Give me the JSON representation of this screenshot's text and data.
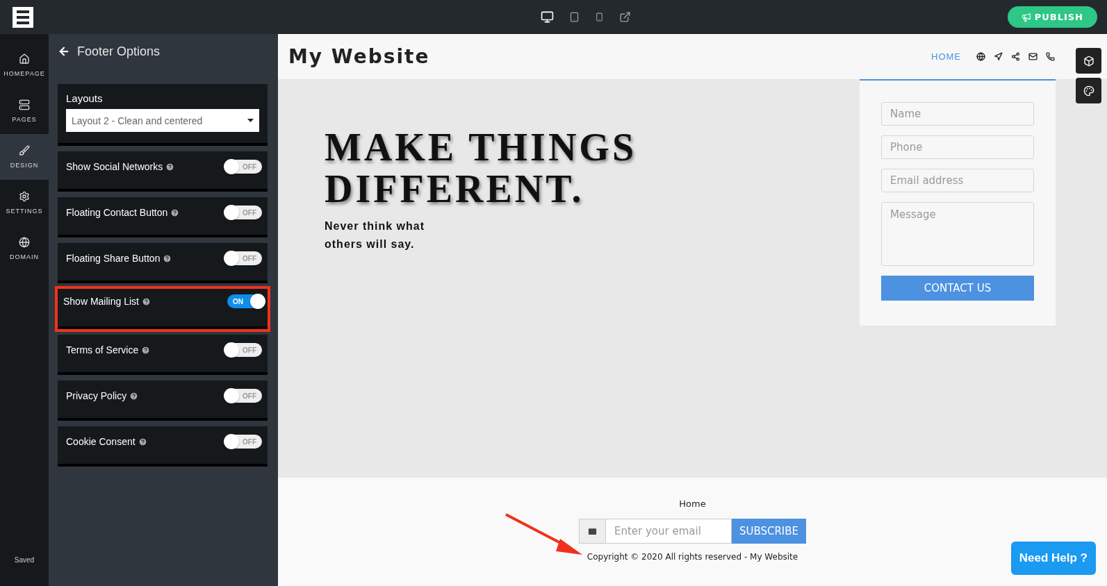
{
  "topbar": {
    "devices": [
      {
        "kind": "desktop",
        "selected": true
      },
      {
        "kind": "tablet",
        "selected": false
      },
      {
        "kind": "phone",
        "selected": false
      },
      {
        "kind": "external",
        "selected": false
      }
    ],
    "publish": "PUBLISH"
  },
  "rail": {
    "items": [
      {
        "kind": "home",
        "label": "HOMEPAGE",
        "selected": false
      },
      {
        "kind": "pages",
        "label": "PAGES",
        "selected": false
      },
      {
        "kind": "design",
        "label": "DESIGN",
        "selected": true
      },
      {
        "kind": "settings",
        "label": "SETTINGS",
        "selected": false
      },
      {
        "kind": "domain",
        "label": "DOMAIN",
        "selected": false
      }
    ],
    "status": "Saved"
  },
  "panel": {
    "title": "Footer Options",
    "layouts": {
      "label": "Layouts",
      "value": "Layout 2 - Clean and centered"
    },
    "options": [
      {
        "label": "Show Social Networks",
        "on": false,
        "state_label": "OFF",
        "highlighted": false
      },
      {
        "label": "Floating Contact Button",
        "on": false,
        "state_label": "OFF",
        "highlighted": false
      },
      {
        "label": "Floating Share Button",
        "on": false,
        "state_label": "OFF",
        "highlighted": false
      },
      {
        "label": "Show Mailing List",
        "on": true,
        "state_label": "ON",
        "highlighted": true
      },
      {
        "label": "Terms of Service",
        "on": false,
        "state_label": "OFF",
        "highlighted": false
      },
      {
        "label": "Privacy Policy",
        "on": false,
        "state_label": "OFF",
        "highlighted": false
      },
      {
        "label": "Cookie Consent",
        "on": false,
        "state_label": "OFF",
        "highlighted": false
      }
    ]
  },
  "preview": {
    "site_title": "My Website",
    "nav": [
      {
        "label": "HOME",
        "selected": true
      }
    ],
    "hero": {
      "title": "MAKE THINGS DIFFERENT.",
      "subtitle": "Never think what others will say."
    },
    "contact_form": {
      "fields": [
        {
          "kind": "input",
          "placeholder": "Name"
        },
        {
          "kind": "input",
          "placeholder": "Phone"
        },
        {
          "kind": "input",
          "placeholder": "Email address"
        },
        {
          "kind": "textarea",
          "placeholder": "Message"
        }
      ],
      "button": "CONTACT US"
    },
    "footer": {
      "link": "Home",
      "email_placeholder": "Enter your email",
      "subscribe": "SUBSCRIBE",
      "copyright": "Copyright © 2020 All rights reserved - My Website"
    }
  },
  "help_button": "Need Help ?"
}
